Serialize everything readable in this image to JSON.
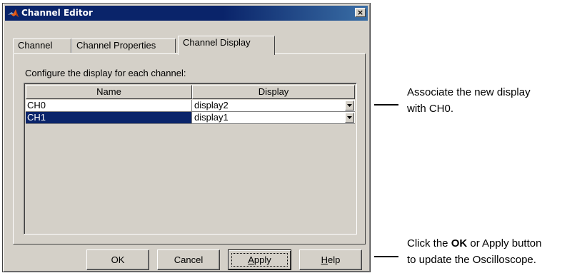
{
  "window": {
    "title": "Channel Editor",
    "close_label": "×"
  },
  "tabs": [
    {
      "label": "Channel"
    },
    {
      "label": "Channel Properties"
    },
    {
      "label": "Channel Display"
    }
  ],
  "panel": {
    "label": "Configure the display for each channel:"
  },
  "table": {
    "columns": [
      "Name",
      "Display"
    ],
    "rows": [
      {
        "name": "CH0",
        "display": "display2",
        "selected": false
      },
      {
        "name": "CH1",
        "display": "display1",
        "selected": true
      }
    ]
  },
  "buttons": {
    "ok": "OK",
    "cancel": "Cancel",
    "apply_mnemonic": "A",
    "apply_rest": "pply",
    "help_mnemonic": "H",
    "help_rest": "elp"
  },
  "callouts": {
    "c1_line1": "Associate the new display",
    "c1_line2": "with CH0.",
    "c2_pre": "Click the ",
    "c2_ok": "OK",
    "c2_mid": " or ",
    "c2_apply": "Apply",
    "c2_post": " button",
    "c2_line2": "to update the Oscilloscope."
  },
  "colors": {
    "selection": "#0a246a",
    "face": "#d4d0c8",
    "titlebar": "#0a246a"
  }
}
